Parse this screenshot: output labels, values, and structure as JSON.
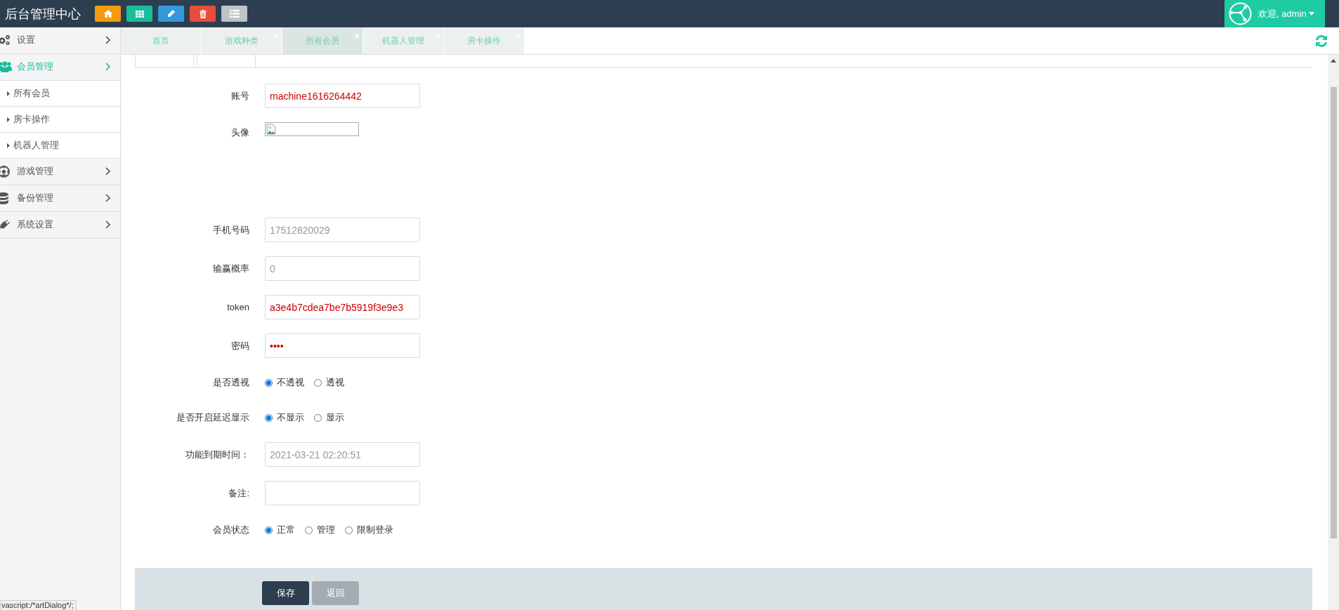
{
  "header": {
    "title": "后台管理中心",
    "toolbar": [
      {
        "kind": "home",
        "color": "#f39c12"
      },
      {
        "kind": "grid",
        "color": "#1abc9c"
      },
      {
        "kind": "pencil",
        "color": "#3498db"
      },
      {
        "kind": "trash",
        "color": "#e74c3c"
      },
      {
        "kind": "list",
        "color": "#bdc3c7"
      }
    ],
    "user": "欢迎, admin"
  },
  "sidebar": {
    "items": [
      {
        "kind": "gears",
        "label": "设置",
        "expanded": false
      },
      {
        "kind": "users",
        "label": "会员管理",
        "expanded": true,
        "children": [
          {
            "label": "所有会员"
          },
          {
            "label": "房卡操作"
          },
          {
            "label": "机器人管理"
          }
        ]
      },
      {
        "kind": "ball",
        "label": "游戏管理",
        "expanded": false
      },
      {
        "kind": "database",
        "label": "备份管理",
        "expanded": false
      },
      {
        "kind": "plug",
        "label": "系统设置",
        "expanded": false
      }
    ]
  },
  "tabs": [
    {
      "label": "首页",
      "selected": false,
      "closable": false
    },
    {
      "label": "游戏种类",
      "selected": false,
      "closable": true
    },
    {
      "label": "所有会员",
      "selected": true,
      "closable": true
    },
    {
      "label": "机器人管理",
      "selected": false,
      "closable": true
    },
    {
      "label": "房卡操作",
      "selected": false,
      "closable": true
    }
  ],
  "form": {
    "fields": [
      {
        "kind": "input",
        "label": "账号",
        "value": "machine1616264442",
        "readonly": false
      },
      {
        "kind": "avatar",
        "label": "头像"
      },
      {
        "kind": "input",
        "label": "手机号码",
        "value": "17512820029",
        "readonly": true
      },
      {
        "kind": "input",
        "label": "输赢概率",
        "value": "0",
        "readonly": true
      },
      {
        "kind": "input",
        "label": "token",
        "value": "a3e4b7cdea7be7b5919f3e9e3",
        "readonly": false
      },
      {
        "kind": "input",
        "label": "密码",
        "value": "••••",
        "readonly": false
      },
      {
        "kind": "radio",
        "label": "是否透视",
        "options": [
          {
            "label": "不透视",
            "selected": true
          },
          {
            "label": "透视",
            "selected": false
          }
        ]
      },
      {
        "kind": "radio",
        "label": "是否开启延迟显示",
        "options": [
          {
            "label": "不显示",
            "selected": true
          },
          {
            "label": "显示",
            "selected": false
          }
        ]
      },
      {
        "kind": "input",
        "label": "功能到期时间：",
        "value": "2021-03-21 02:20:51",
        "readonly": true
      },
      {
        "kind": "input",
        "label": "备注:"
      },
      {
        "kind": "radio",
        "label": "会员状态",
        "options": [
          {
            "label": "正常",
            "selected": true
          },
          {
            "label": "管理",
            "selected": false
          },
          {
            "label": "限制登录",
            "selected": false
          }
        ]
      }
    ],
    "buttons": [
      {
        "label": "保存",
        "disabled": false
      },
      {
        "label": "返回",
        "disabled": true
      }
    ]
  },
  "status_tip": "vascript:/*artDialog*/;"
}
